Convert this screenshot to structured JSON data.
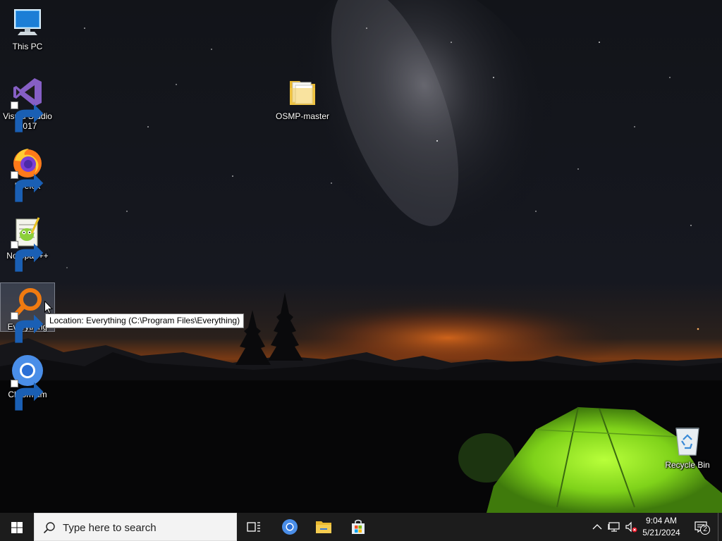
{
  "desktop": {
    "icons": [
      {
        "label": "This PC",
        "icon": "computer-icon",
        "shortcut": false
      },
      {
        "label": "Visual Studio 2017",
        "icon": "visual-studio-icon",
        "shortcut": true
      },
      {
        "label": "Firefox",
        "icon": "firefox-icon",
        "shortcut": true
      },
      {
        "label": "Notepad++",
        "icon": "notepad-plus-plus-icon",
        "shortcut": true
      },
      {
        "label": "Everything",
        "icon": "everything-search-icon",
        "shortcut": true,
        "selected": true
      },
      {
        "label": "Chromium",
        "icon": "chromium-icon",
        "shortcut": true
      },
      {
        "label": "OSMP-master",
        "icon": "folder-icon",
        "shortcut": false
      },
      {
        "label": "Recycle Bin",
        "icon": "recycle-bin-icon",
        "shortcut": false
      }
    ],
    "tooltip": "Location: Everything (C:\\Program Files\\Everything)"
  },
  "taskbar": {
    "start_icon": "windows-logo-icon",
    "search_placeholder": "Type here to search",
    "pinned": [
      {
        "name": "task-view",
        "icon": "task-view-icon"
      },
      {
        "name": "chromium",
        "icon": "chromium-icon"
      },
      {
        "name": "file-explorer",
        "icon": "folder-icon"
      },
      {
        "name": "microsoft-store",
        "icon": "store-icon"
      }
    ],
    "tray": {
      "icons": [
        "chevron-up-icon",
        "network-icon",
        "volume-muted-icon"
      ],
      "time": "9:04 AM",
      "date": "5/21/2024",
      "notification_count": "2"
    }
  },
  "colors": {
    "taskbar": "#1c1c1c",
    "tent": "#8fe01f",
    "horizon_glow": "#d8681c",
    "chromium_blue": "#4a8ee8"
  }
}
